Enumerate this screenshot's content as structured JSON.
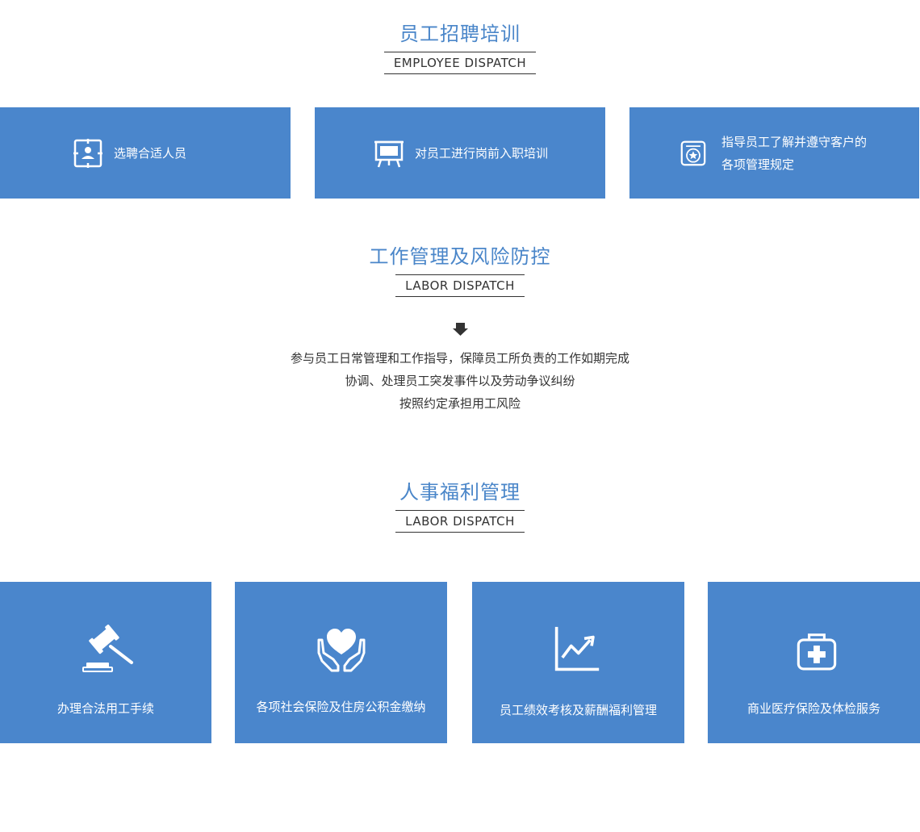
{
  "sections": [
    {
      "title": "员工招聘培训",
      "subtitle": "EMPLOYEE DISPATCH"
    },
    {
      "title": "工作管理及风险防控",
      "subtitle": "LABOR DISPATCH"
    },
    {
      "title": "人事福利管理",
      "subtitle": "LABOR DISPATCH"
    }
  ],
  "recruit_cards": [
    {
      "icon": "id-card-icon",
      "line1": "选聘合适人员",
      "line2": ""
    },
    {
      "icon": "presentation-board-icon",
      "line1": "对员工进行岗前入职培训",
      "line2": ""
    },
    {
      "icon": "badge-star-icon",
      "line1": "指导员工了解并遵守客户的",
      "line2": "各项管理规定"
    }
  ],
  "risk_lines": [
    "参与员工日常管理和工作指导，保障员工所负责的工作如期完成",
    "协调、处理员工突发事件以及劳动争议纠纷",
    "按照约定承担用工风险"
  ],
  "welfare_cards": [
    {
      "icon": "gavel-icon",
      "label": "办理合法用工手续"
    },
    {
      "icon": "heart-hands-icon",
      "label": "各项社会保险及住房公积金缴纳"
    },
    {
      "icon": "trend-chart-icon",
      "label": "员工绩效考核及薪酬福利管理"
    },
    {
      "icon": "medical-kit-icon",
      "label": "商业医疗保险及体检服务"
    }
  ],
  "colors": {
    "accent": "#4a86c9",
    "card": "#4a86cc",
    "text": "#333333"
  }
}
